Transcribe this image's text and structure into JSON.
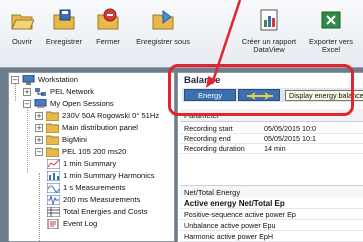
{
  "toolbar": {
    "buttons": [
      {
        "label": "Ouvrir",
        "icon": "open-folder-icon"
      },
      {
        "label": "Enregistrer",
        "icon": "save-icon"
      },
      {
        "label": "Fermer",
        "icon": "close-folder-icon"
      },
      {
        "label": "Enregistrer sous",
        "icon": "save-as-icon"
      },
      {
        "label": "Créer un rapport DataView",
        "icon": "report-icon"
      },
      {
        "label": "Exporter vers Excel",
        "icon": "excel-export-icon"
      }
    ]
  },
  "tree": {
    "nodes": [
      {
        "label": "Workstation",
        "icon": "workstation-icon"
      },
      {
        "label": "PEL Network",
        "icon": "network-icon"
      },
      {
        "label": "My Open Sessions",
        "icon": "sessions-icon"
      },
      {
        "label": "230V 50A Rogowski 0° 51Hz",
        "icon": "folder-icon"
      },
      {
        "label": "Main distribution panel",
        "icon": "folder-icon"
      },
      {
        "label": "BigMini",
        "icon": "folder-icon"
      },
      {
        "label": "PEL 105 200 ms20",
        "icon": "folder-icon"
      },
      {
        "label": "1 min Summary",
        "icon": "chart-icon"
      },
      {
        "label": "1 min Summary Harmonics",
        "icon": "chart-icon"
      },
      {
        "label": "1 s Measurements",
        "icon": "chart-icon"
      },
      {
        "label": "200 ms Measurements",
        "icon": "chart-icon"
      },
      {
        "label": "Total Energies and Costs",
        "icon": "table-icon"
      },
      {
        "label": "Event Log",
        "icon": "log-icon"
      }
    ]
  },
  "balance": {
    "title": "Balance",
    "tab_energy": "Energy",
    "tooltip": "Display energy balance",
    "param_header": "Parameter",
    "params": [
      {
        "key": "Recording start",
        "value": "05/05/2015 10:0"
      },
      {
        "key": "Recording end",
        "value": "05/05/2015 10:1"
      },
      {
        "key": "Recording duration",
        "value": "14 min"
      }
    ],
    "section_header": "Net/Total Energy",
    "energy_rows": [
      "Active energy Net/Total Ep",
      "Positive-sequence active power Ep",
      "Unbalance active power Epu",
      "Harmonic active power EpH"
    ]
  },
  "colors": {
    "highlight": "#e3232e",
    "tab": "#3c6fb0"
  }
}
